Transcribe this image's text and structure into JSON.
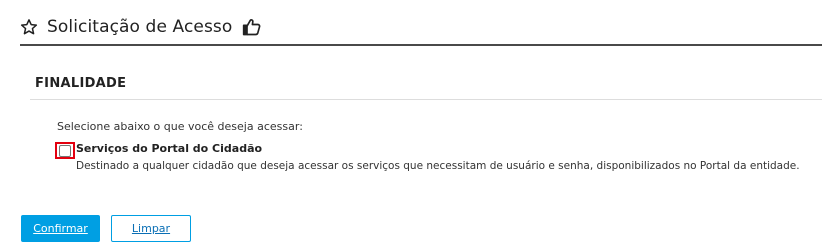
{
  "header": {
    "title": "Solicitação de Acesso",
    "star_icon": "star-outline-icon",
    "like_icon": "thumbs-up-icon"
  },
  "section": {
    "title": "FINALIDADE",
    "instructions": "Selecione abaixo o que você deseja acessar:"
  },
  "options": [
    {
      "label": "Serviços do Portal do Cidadão",
      "description": "Destinado a qualquer cidadão que deseja acessar os serviços que necessitam de usuário e senha, disponibilizados no Portal da entidade.",
      "checked": false
    }
  ],
  "buttons": {
    "confirm_label": "Confirmar",
    "clear_label": "Limpar"
  },
  "colors": {
    "accent": "#009fe3",
    "highlight": "#e3000f",
    "header_rule": "#4a4a4a"
  }
}
